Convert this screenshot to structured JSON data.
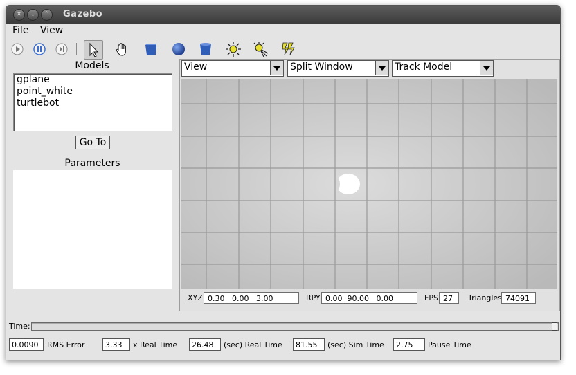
{
  "window": {
    "title": "Gazebo"
  },
  "menu": {
    "file": "File",
    "view": "View"
  },
  "toolbar": {
    "icons": [
      "play-icon",
      "pause-icon",
      "step-icon",
      "arrow-cursor-icon",
      "hand-icon",
      "box-icon",
      "sphere-icon",
      "cylinder-icon",
      "point-light-icon",
      "spot-light-icon",
      "directional-light-icon"
    ]
  },
  "models": {
    "heading": "Models",
    "items": [
      "gplane",
      "point_white",
      "turtlebot"
    ],
    "goto_label": "Go To"
  },
  "parameters": {
    "heading": "Parameters"
  },
  "viewport": {
    "view_select": "View",
    "split_select": "Split Window",
    "track_select": "Track Model"
  },
  "stats": {
    "xyz_label": "XYZ",
    "xyz_value": "0.30   0.00   3.00",
    "rpy_label": "RPY",
    "rpy_value": "0.00  90.00   0.00",
    "fps_label": "FPS",
    "fps_value": "27",
    "tri_label": "Triangles",
    "tri_value": "74091"
  },
  "time": {
    "label": "Time:"
  },
  "status": {
    "rms_value": "0.0090",
    "rms_label": "RMS Error",
    "xrt_value": "3.33",
    "xrt_label": "x Real Time",
    "real_value": "26.48",
    "real_label": "(sec) Real Time",
    "sim_value": "81.55",
    "sim_label": "(sec) Sim Time",
    "pause_value": "2.75",
    "pause_label": "Pause Time"
  },
  "colors": {
    "accent_yellow": "#e8e030",
    "model_blue": "#2f5db8"
  }
}
